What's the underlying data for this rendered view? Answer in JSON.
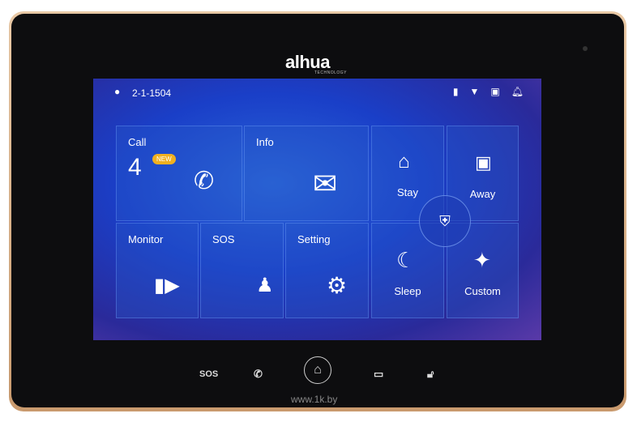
{
  "brand": {
    "logo": "alhua",
    "tagline": "TECHNOLOGY"
  },
  "status": {
    "location": "2-1-1504",
    "icons": [
      "location-pin-icon",
      "sd-card-icon",
      "wifi-icon",
      "door-station-icon",
      "bell-icon"
    ]
  },
  "tiles": {
    "call": {
      "label": "Call",
      "count": "4",
      "badge": "NEW"
    },
    "info": {
      "label": "Info"
    },
    "stay": {
      "label": "Stay"
    },
    "away": {
      "label": "Away"
    },
    "monitor": {
      "label": "Monitor"
    },
    "sos": {
      "label": "SOS"
    },
    "setting": {
      "label": "Setting"
    },
    "sleep": {
      "label": "Sleep"
    },
    "custom": {
      "label": "Custom"
    }
  },
  "hardware": {
    "sos": "SOS"
  },
  "watermark": "www.1k.by",
  "colors": {
    "badge": "#f0b020",
    "screen": "#1a3fc8"
  }
}
